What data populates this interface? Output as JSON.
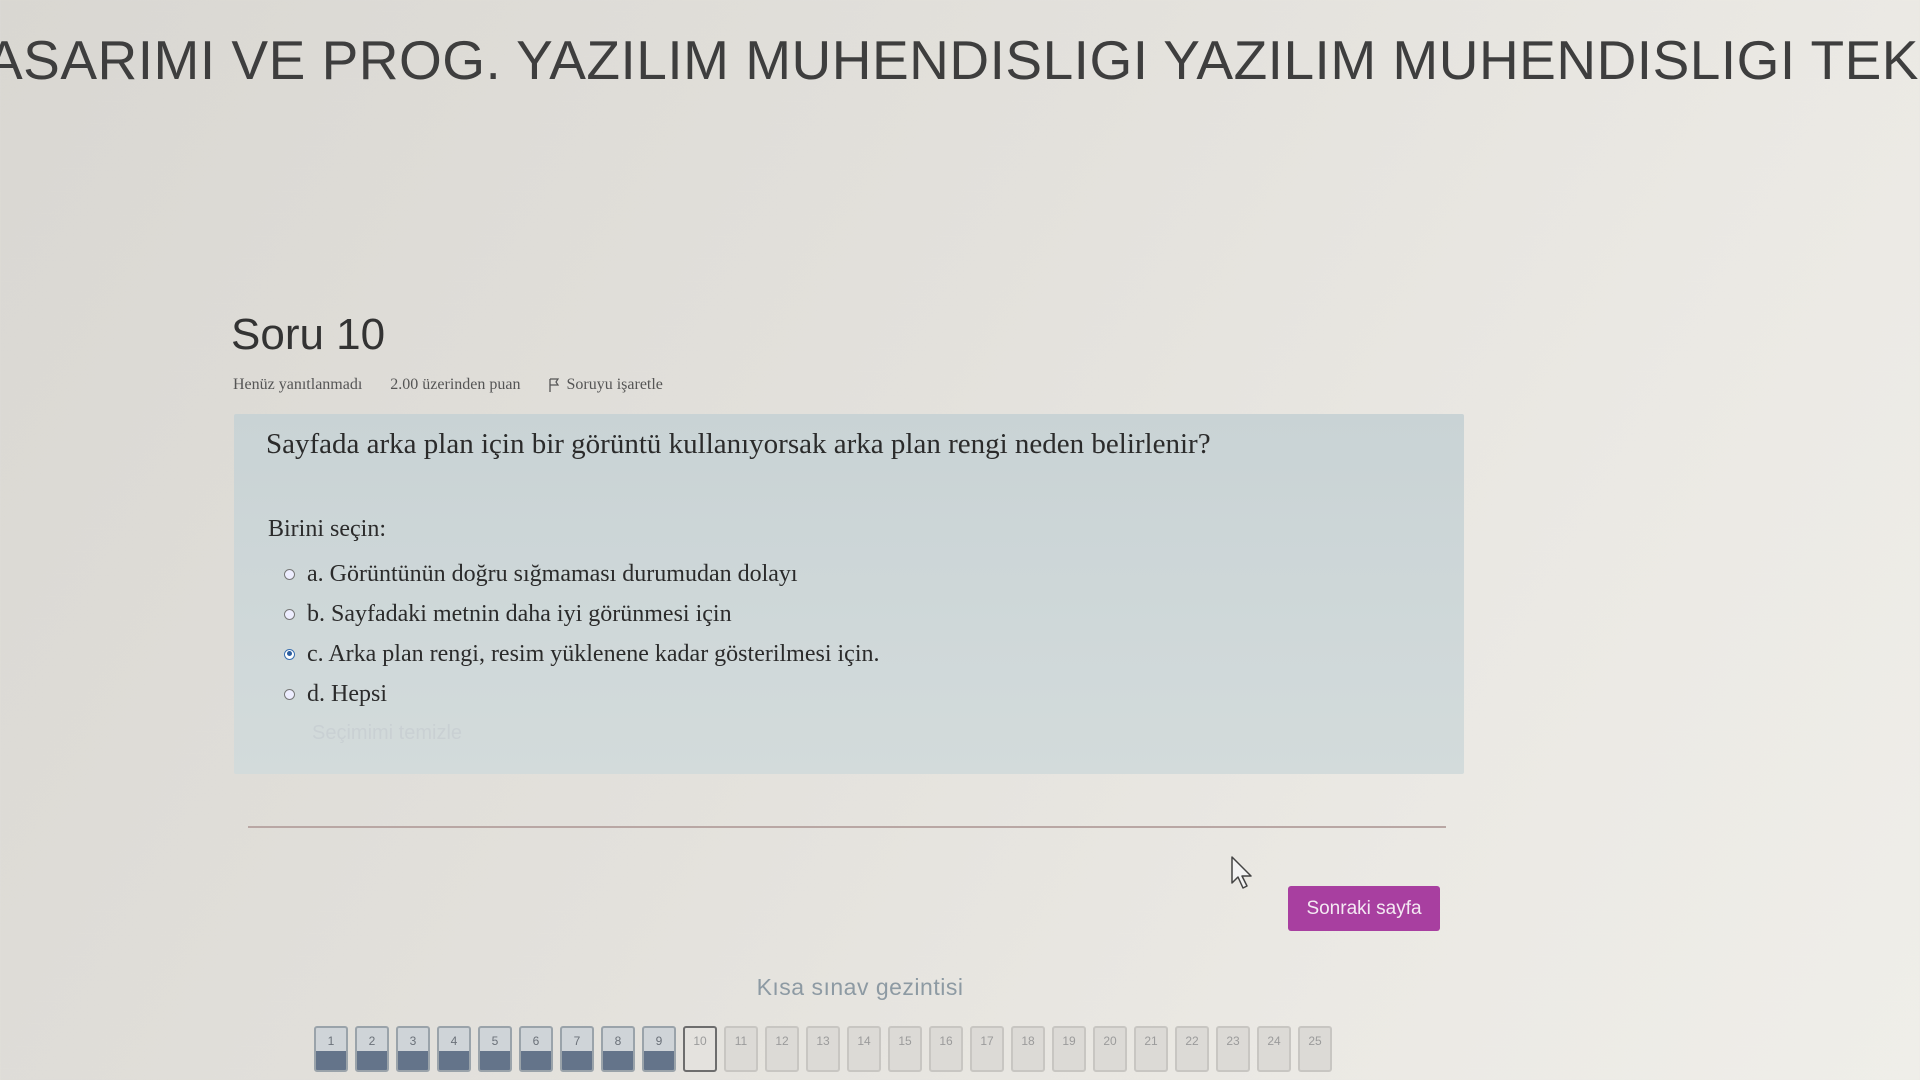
{
  "course": {
    "title": "ASARIMI VE PROG. YAZILIM MUHENDISLIGI YAZILIM MUHENDISLIGI TEKNOLO"
  },
  "question": {
    "heading": "Soru 10",
    "status": "Henüz yanıtlanmadı",
    "points": "2.00 üzerinden puan",
    "flag_label": "Soruyu işaretle",
    "text": "Sayfada arka plan için bir görüntü kullanıyorsak arka plan rengi neden belirlenir?",
    "prompt": "Birini seçin:",
    "answers": [
      {
        "label": "a. Görüntünün doğru sığmaması durumudan dolayı",
        "selected": false
      },
      {
        "label": "b. Sayfadaki metnin daha iyi görünmesi için",
        "selected": false
      },
      {
        "label": "c. Arka plan rengi, resim yüklenene kadar gösterilmesi için.",
        "selected": true
      },
      {
        "label": "d. Hepsi",
        "selected": false
      }
    ],
    "clear_choice": "Seçimimi temizle"
  },
  "navigation": {
    "next_button": "Sonraki sayfa",
    "quiz_nav_title": "Kısa sınav gezintisi",
    "current": 10,
    "answered": [
      1,
      2,
      3,
      4,
      5,
      6,
      7,
      8,
      9
    ],
    "buttons": [
      "1",
      "2",
      "3",
      "4",
      "5",
      "6",
      "7",
      "8",
      "9",
      "10",
      "11",
      "12",
      "13",
      "14",
      "15",
      "16",
      "17",
      "18",
      "19",
      "20",
      "21",
      "22",
      "23",
      "24",
      "25"
    ]
  },
  "colors": {
    "next_button": "#a83fa0",
    "answered_fill": "#64748a",
    "question_box": "#cfd8d9"
  },
  "icons": {
    "flag": "flag-icon",
    "cursor": "mouse-pointer-icon",
    "radio": "radio-icon"
  }
}
